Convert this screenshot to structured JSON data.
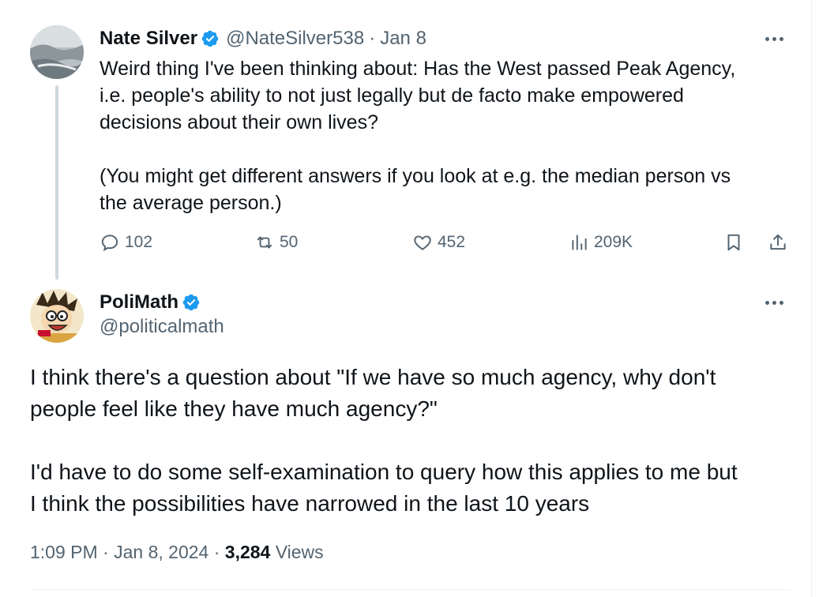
{
  "tweet1": {
    "name": "Nate Silver",
    "handle": "@NateSilver538",
    "sep": "·",
    "date": "Jan 8",
    "text": "Weird thing I've been thinking about: Has the West passed Peak Agency,\ni.e. people's ability to not just legally but de facto make empowered\ndecisions about their own lives?\n\n(You might get different answers if you look at e.g. the median person vs\nthe average person.)",
    "replies": "102",
    "retweets": "50",
    "likes": "452",
    "views": "209K"
  },
  "tweet2": {
    "name": "PoliMath",
    "handle": "@politicalmath",
    "text": "I think there's a question about \"If we have so much agency, why don't\npeople feel like they have much agency?\"\n\nI'd have to do some self-examination to query how this applies to me but\nI think the possibilities have narrowed in the last 10 years",
    "time": "1:09 PM",
    "date": "Jan 8, 2024",
    "views_count": "3,284",
    "views_label": "Views"
  },
  "colors": {
    "verified": "#1d9bf0",
    "secondary_text": "#536471",
    "thread_line": "#cfd9de"
  },
  "icons": [
    "verified-badge-icon",
    "more-icon",
    "reply-icon",
    "retweet-icon",
    "like-icon",
    "views-icon",
    "bookmark-icon",
    "share-icon"
  ]
}
